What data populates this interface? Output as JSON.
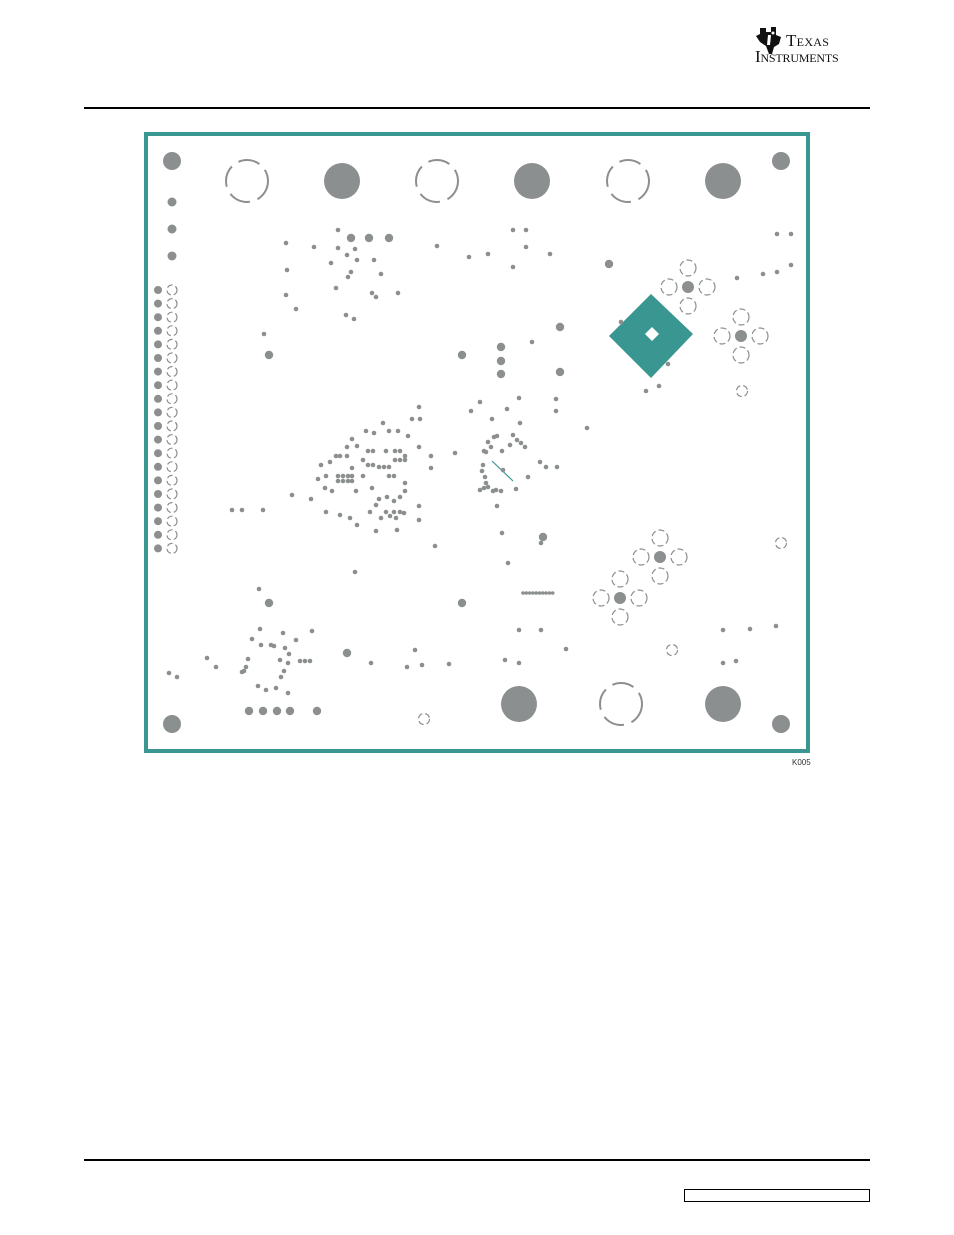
{
  "header": {
    "logo": {
      "line1": "Texas",
      "line2": "Instruments",
      "icon": "ti-state-logo-icon"
    }
  },
  "figure": {
    "label": "K005",
    "colors": {
      "board_outline": "#3a9690",
      "copper": "#3a9690",
      "via": "#8c8f8f",
      "pad_outline": "#8c8f8f"
    }
  },
  "footer": {
    "box_text": ""
  }
}
